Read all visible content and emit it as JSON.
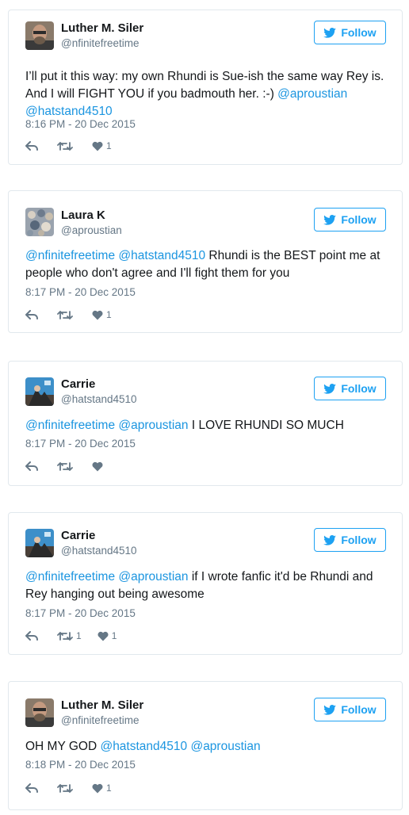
{
  "tweets": [
    {
      "name": "Luther M. Siler",
      "handle": "@nfinitefreetime",
      "follow_label": "Follow",
      "text_1": "I’ll put it this way: my own Rhundi is Sue-ish the same way Rey is. And I will FIGHT YOU if you badmouth her.  :-) ",
      "mention_1": "@aproustian",
      "mention_2": "@hatstand4510",
      "time": "8:16 PM - 20 Dec 2015",
      "retweets": "",
      "likes": "1"
    },
    {
      "name": "Laura K",
      "handle": "@aproustian",
      "follow_label": "Follow",
      "mention_1": "@nfinitefreetime",
      "mention_2": "@hatstand4510",
      "text_1": " Rhundi is the BEST point me at people who don't agree and I'll fight them for you",
      "time": "8:17 PM - 20 Dec 2015",
      "retweets": "",
      "likes": "1"
    },
    {
      "name": "Carrie",
      "handle": "@hatstand4510",
      "follow_label": "Follow",
      "mention_1": "@nfinitefreetime",
      "mention_2": "@aproustian",
      "text_1": " I LOVE RHUNDI SO MUCH",
      "time": "8:17 PM - 20 Dec 2015",
      "retweets": "",
      "likes": ""
    },
    {
      "name": "Carrie",
      "handle": "@hatstand4510",
      "follow_label": "Follow",
      "mention_1": "@nfinitefreetime",
      "mention_2": "@aproustian",
      "text_1": " if I wrote fanfic it'd be Rhundi and Rey hanging out being awesome",
      "time": "8:17 PM - 20 Dec 2015",
      "retweets": "1",
      "likes": "1"
    },
    {
      "name": "Luther M. Siler",
      "handle": "@nfinitefreetime",
      "follow_label": "Follow",
      "text_1": "OH MY GOD ",
      "mention_1": "@hatstand4510",
      "mention_2": "@aproustian",
      "time": "8:18 PM - 20 Dec 2015",
      "retweets": "",
      "likes": "1"
    }
  ],
  "colors": {
    "accent": "#1da1f2",
    "link": "#1b95e0",
    "muted": "#657786",
    "border": "#e1e8ed"
  },
  "icons": {
    "follow": "twitter-bird-icon",
    "reply": "reply-icon",
    "retweet": "retweet-icon",
    "like": "heart-icon"
  }
}
